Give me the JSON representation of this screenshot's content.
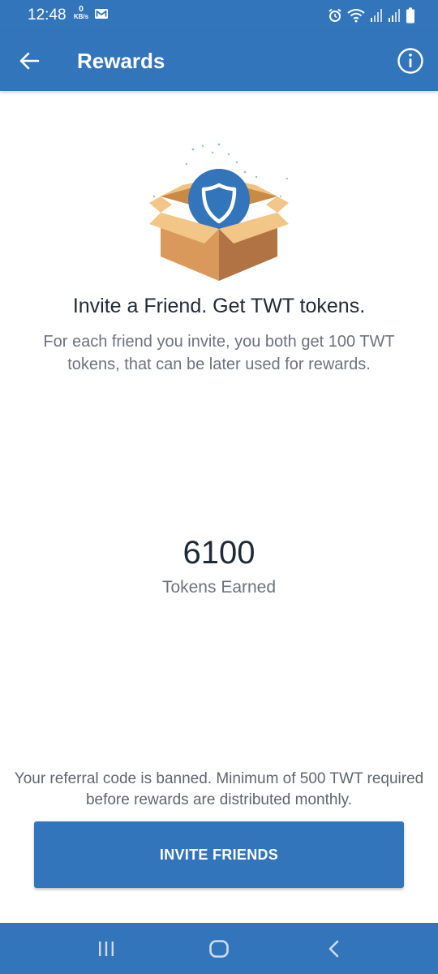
{
  "status_bar": {
    "time": "12:48",
    "net_speed_value": "0",
    "net_speed_unit": "KB/s",
    "icons": [
      "mail-icon",
      "alarm-icon",
      "wifi-icon",
      "signal-icon",
      "signal-icon",
      "battery-icon"
    ]
  },
  "app_bar": {
    "title": "Rewards",
    "back_icon": "back-arrow-icon",
    "info_icon": "info-icon"
  },
  "hero": {
    "illustration": "gift-box-with-shield-icon"
  },
  "headline": "Invite a Friend. Get TWT tokens.",
  "description": "For each friend you invite, you both get 100 TWT tokens, that can be later used for rewards.",
  "tokens": {
    "count": "6100",
    "label": "Tokens Earned"
  },
  "notice": "Your referral code is banned. Minimum of 500 TWT required before rewards are distributed monthly.",
  "invite_button_label": "INVITE FRIENDS",
  "nav_bar": {
    "buttons": [
      "recents-icon",
      "home-icon",
      "back-icon"
    ]
  },
  "colors": {
    "primary": "#3375BB",
    "text_dark": "#1f2a37",
    "text_muted": "#6b7280"
  }
}
